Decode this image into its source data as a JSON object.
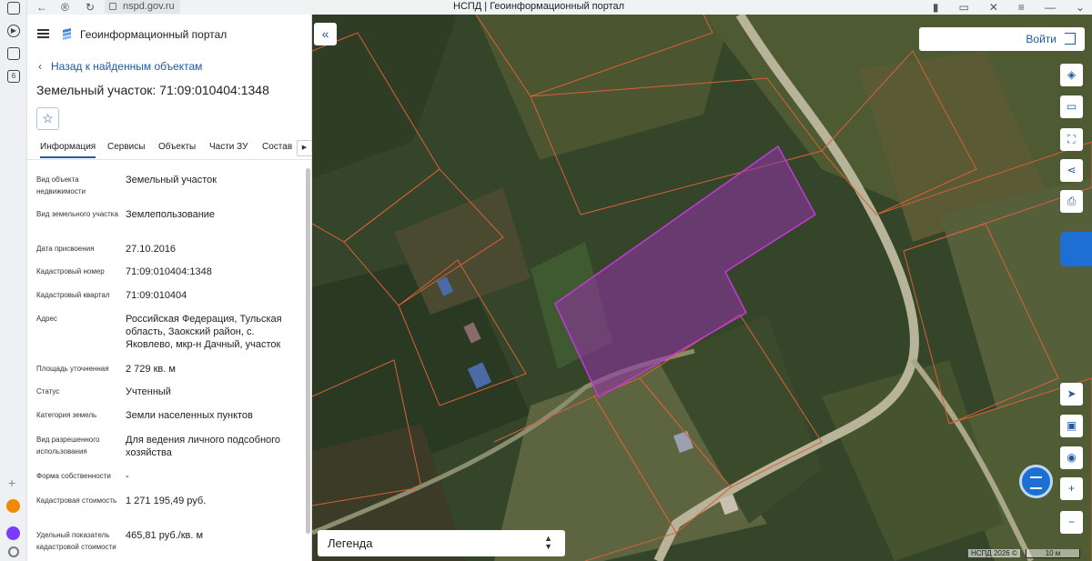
{
  "browser": {
    "url": "nspd.gov.ru",
    "page_title": "НСПД | Геоинформационный портал",
    "sidebar_badge": "6"
  },
  "header": {
    "app_title": "Геоинформационный портал"
  },
  "panel": {
    "back_label": "Назад к найденным объектам",
    "title": "Земельный участок: 71:09:010404:1348",
    "tabs": [
      {
        "label": "Информация",
        "active": true
      },
      {
        "label": "Сервисы"
      },
      {
        "label": "Объекты"
      },
      {
        "label": "Части ЗУ"
      },
      {
        "label": "Состав"
      }
    ],
    "rows": [
      {
        "label": "Вид объекта недвижимости",
        "value": "Земельный участок"
      },
      {
        "label": "Вид земельного участка",
        "value": "Землепользование"
      },
      {
        "label": "Дата присвоения",
        "value": "27.10.2016"
      },
      {
        "label": "Кадастровый номер",
        "value": "71:09:010404:1348"
      },
      {
        "label": "Кадастровый квартал",
        "value": "71:09:010404"
      },
      {
        "label": "Адрес",
        "value": "Российская Федерация, Тульская область, Заокский район, с. Яковлево, мкр-н Дачный, участок"
      },
      {
        "label": "Площадь уточненная",
        "value": "2 729 кв. м"
      },
      {
        "label": "Статус",
        "value": "Учтенный"
      },
      {
        "label": "Категория земель",
        "value": "Земли населенных пунктов"
      },
      {
        "label": "Вид разрешенного использования",
        "value": "Для ведения личного подсобного хозяйства"
      },
      {
        "label": "Форма собственности",
        "value": "-"
      },
      {
        "label": "Кадастровая стоимость",
        "value": "1 271 195,49 руб."
      },
      {
        "label": "Удельный показатель кадастровой стоимости",
        "value": "465,81 руб./кв. м"
      }
    ]
  },
  "map": {
    "login_label": "Войти",
    "legend_label": "Легенда",
    "copyright": "НСПД 2026 ©",
    "scale_label": "10 м",
    "selected_color": "#c03bd6",
    "parcel_line_color": "#d9603a"
  }
}
